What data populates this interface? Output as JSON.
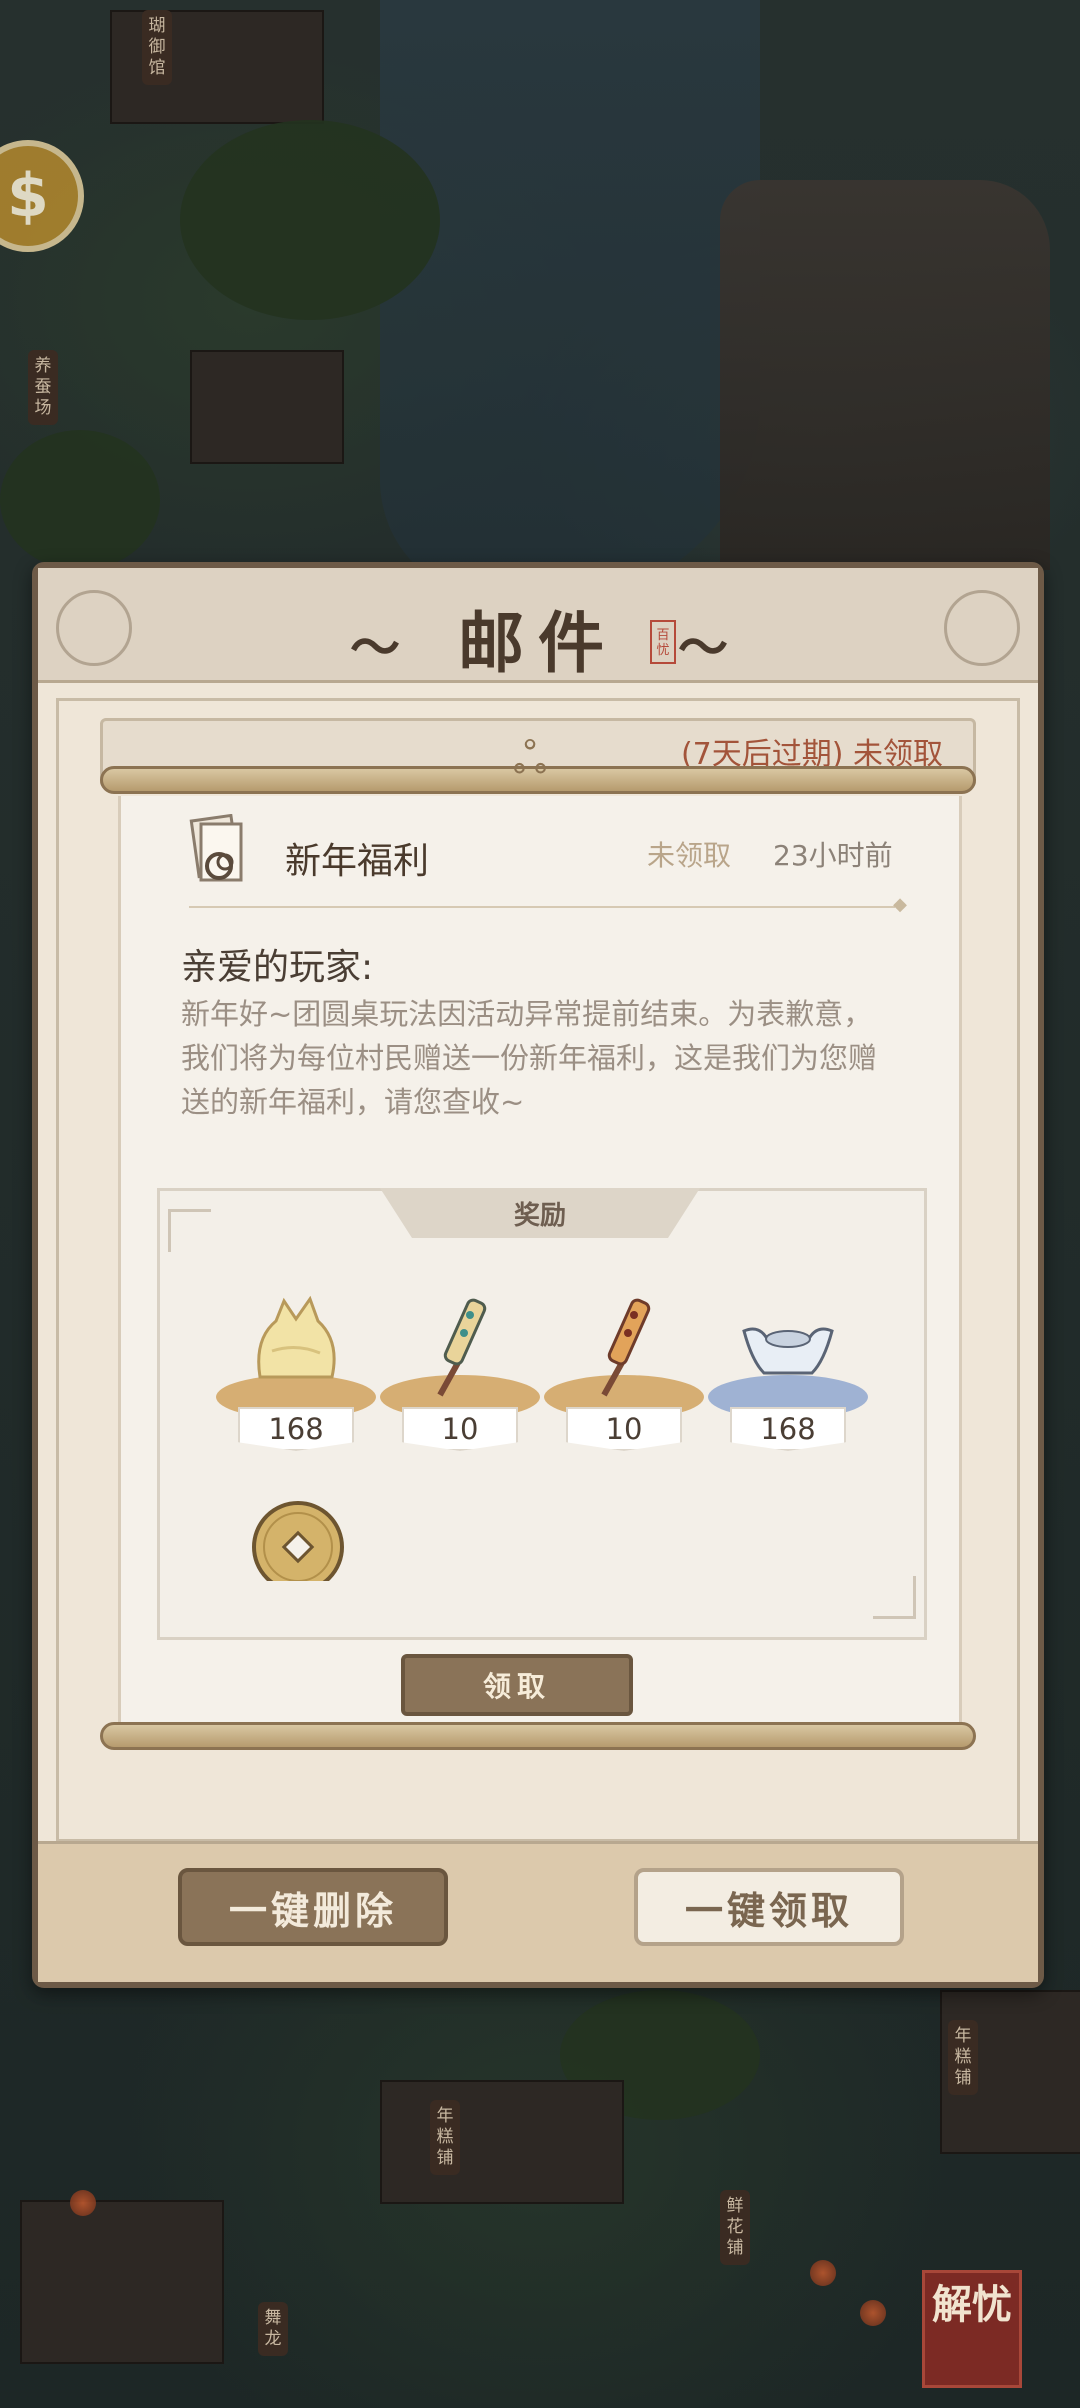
{
  "scene": {
    "signs": [
      "瑚御馆",
      "养蚕场",
      "年糕铺",
      "年糕铺",
      "鲜花铺",
      "舞龙"
    ],
    "corner_seal": "解忧"
  },
  "mail": {
    "title": "邮件",
    "stamp": "百忧",
    "list_row_text": "(7天后过期)  未领取",
    "buttons": {
      "delete_all": "一键删除",
      "claim_all": "一键领取"
    }
  },
  "detail": {
    "title": "新年福利",
    "status": "未领取",
    "time": "23小时前",
    "greeting": "亲爱的玩家:",
    "body": "新年好~团圆桌玩法因活动异常提前结束。为表歉意，我们将为每位村民赠送一份新年福利，这是我们为您赠送的新年福利，请您查收~",
    "rewards_label": "奖励",
    "rewards": [
      {
        "name": "cake-icon",
        "count": "168",
        "plate": "gold"
      },
      {
        "name": "firework-stick-icon",
        "count": "10",
        "plate": "gold"
      },
      {
        "name": "firework-stick-icon",
        "count": "10",
        "plate": "gold"
      },
      {
        "name": "silver-ingot-icon",
        "count": "168",
        "plate": "blue"
      },
      {
        "name": "copper-coin-icon",
        "count": "",
        "plate": "none"
      }
    ],
    "claim_button": "领取"
  },
  "colors": {
    "frame": "#6d5a47",
    "paper": "#f5f1ea",
    "accent_red": "#b54a3a",
    "button": "#8a7358"
  }
}
